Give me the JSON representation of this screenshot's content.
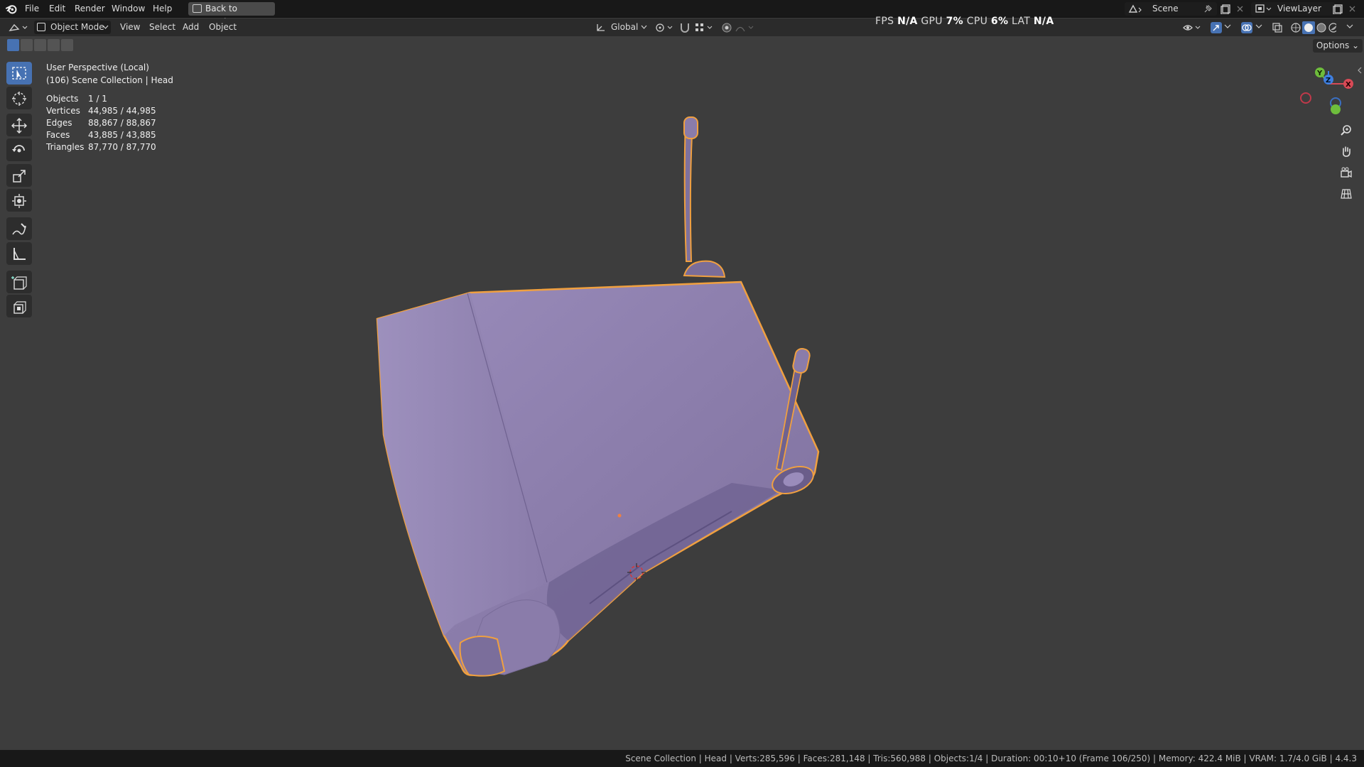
{
  "menu": {
    "items": [
      "File",
      "Edit",
      "Render",
      "Window",
      "Help"
    ],
    "back_button": "Back to Previous",
    "scene": "Scene",
    "view_layer": "ViewLayer"
  },
  "header": {
    "mode": "Object Mode",
    "menus": [
      "View",
      "Select",
      "Add",
      "Object"
    ],
    "orientation": "Global",
    "options": "Options"
  },
  "performance": {
    "fps_label": "FPS",
    "fps_value": "N/A",
    "gpu_label": "GPU",
    "gpu_value": "7%",
    "cpu_label": "CPU",
    "cpu_value": "6%",
    "lat_label": "LAT",
    "lat_value": "N/A"
  },
  "overlay": {
    "view_name": "User Perspective (Local)",
    "collection": "(106) Scene Collection | Head",
    "stats": [
      {
        "label": "Objects",
        "value": "1 / 1"
      },
      {
        "label": "Vertices",
        "value": "44,985 / 44,985"
      },
      {
        "label": "Edges",
        "value": "88,867 / 88,867"
      },
      {
        "label": "Faces",
        "value": "43,885 / 43,885"
      },
      {
        "label": "Triangles",
        "value": "87,770 / 87,770"
      }
    ]
  },
  "gizmo": {
    "x": "X",
    "y": "Y",
    "z": "Z"
  },
  "toolbar": [
    "select-box",
    "cursor",
    "move",
    "rotate",
    "scale",
    "transform",
    "annotate",
    "measure",
    "add-cube",
    "extrude"
  ],
  "status": "Scene Collection | Head | Verts:285,596 | Faces:281,148 | Tris:560,988 | Objects:1/4 | Duration: 00:10+10 (Frame 106/250) | Memory: 422.4 MiB | VRAM: 1.7/4.0 GiB | 4.4.3",
  "colors": {
    "viewport_bg": "#3d3d3d",
    "object_fill": "#8e80ad",
    "selection_outline": "#f0a040",
    "active_tool": "#4772b3"
  }
}
